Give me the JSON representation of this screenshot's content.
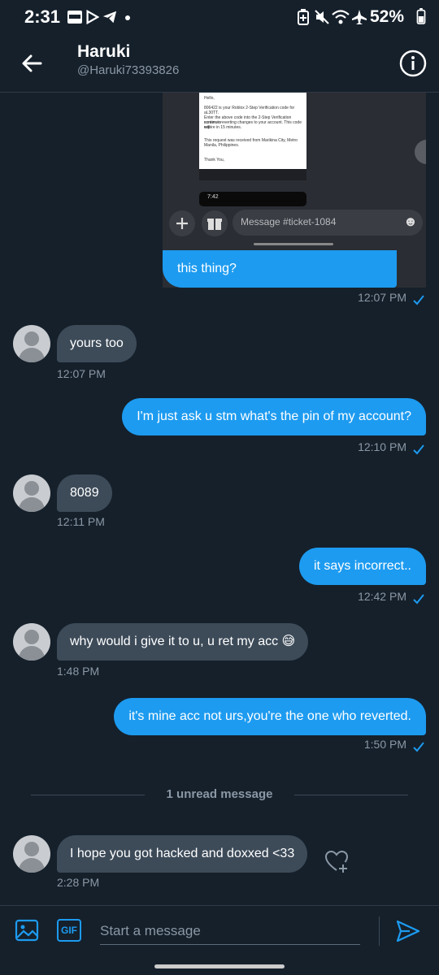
{
  "status_bar": {
    "time": "2:31",
    "battery": "52%",
    "icons": [
      "webtoon-icon",
      "play-icon",
      "telegram-icon",
      "dot-icon",
      "battery-saver-icon",
      "mute-icon",
      "wifi-icon",
      "airplane-icon",
      "battery-icon"
    ]
  },
  "header": {
    "name": "Haruki",
    "handle": "@Haruki73393826"
  },
  "screenshot": {
    "email_lines": [
      "Hello,",
      "806422 is your Roblox 2-Step Verification code for aL30TT.",
      "Enter the above code into the 2-Step Verification screen to",
      "continue reverting changes to your account. This code will",
      "expire in 15 minutes.",
      "This request was received from Marikina City, Metro",
      "Manila, Philippines.",
      "Thank You,"
    ],
    "phone_time": "7:42",
    "input_placeholder": "Message #ticket-1084"
  },
  "messages": [
    {
      "dir": "out",
      "text": "this thing?",
      "time": "12:07 PM"
    },
    {
      "dir": "in",
      "text": "yours too",
      "time": "12:07 PM"
    },
    {
      "dir": "out",
      "text": "I'm just ask u stm what's the pin of my account?",
      "time": "12:10 PM"
    },
    {
      "dir": "in",
      "text": "8089",
      "time": "12:11 PM"
    },
    {
      "dir": "out",
      "text": "it says incorrect..",
      "time": "12:42 PM"
    },
    {
      "dir": "in",
      "text": "why would i give it to u, u ret my acc 😅",
      "time": "1:48 PM"
    },
    {
      "dir": "out",
      "text": "it's mine acc not urs,you're the one who reverted.",
      "time": "1:50 PM"
    },
    {
      "dir": "in",
      "text": "I hope you got hacked and doxxed <33",
      "time": "2:28 PM"
    }
  ],
  "unread_label": "1 unread message",
  "composer": {
    "placeholder": "Start a message",
    "gif_label": "GIF"
  },
  "colors": {
    "background": "#15202b",
    "accent": "#1d9bf0",
    "incoming_bubble": "#3d4b59",
    "muted_text": "#8b98a5"
  }
}
